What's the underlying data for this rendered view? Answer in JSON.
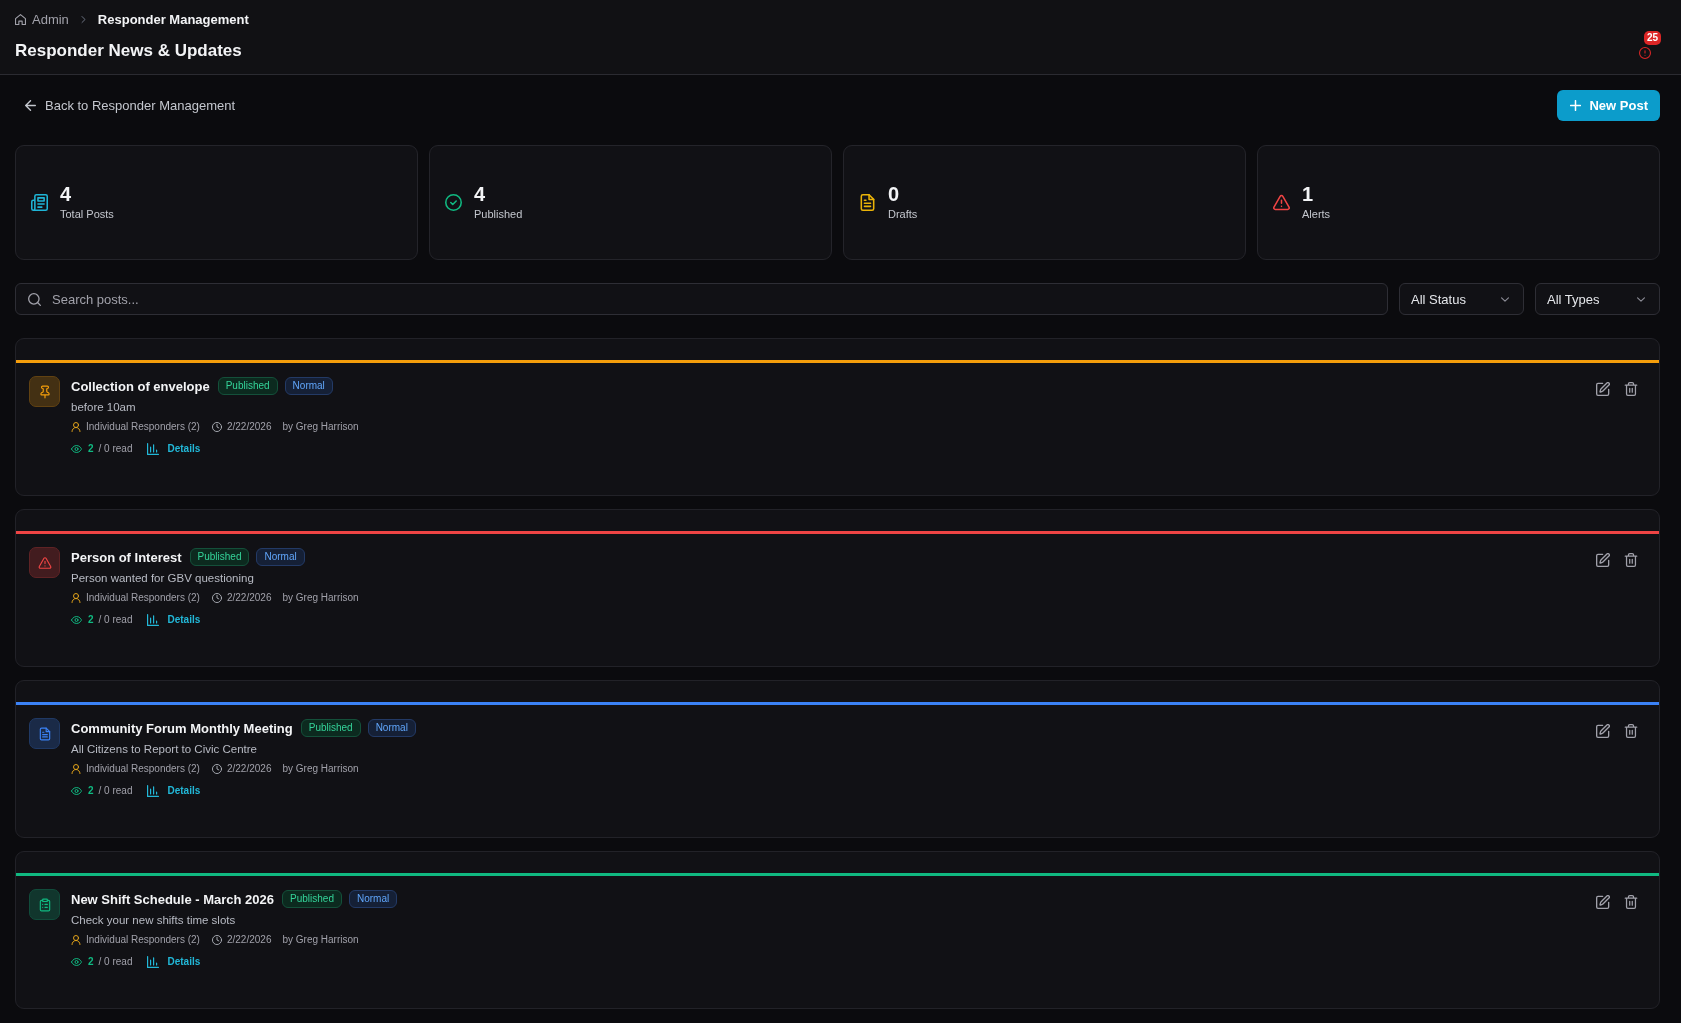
{
  "breadcrumb": [
    {
      "label": "Admin",
      "current": false
    },
    {
      "label": "Responder Management",
      "current": true
    }
  ],
  "page_title": "Responder News & Updates",
  "notifications": {
    "count": "25"
  },
  "back_link": "Back to Responder Management",
  "new_post_button": "New Post",
  "stats": [
    {
      "value": "4",
      "label": "Total Posts",
      "kind": "total",
      "color": "#1fb5d6"
    },
    {
      "value": "4",
      "label": "Published",
      "kind": "published",
      "color": "#10b981"
    },
    {
      "value": "0",
      "label": "Drafts",
      "kind": "drafts",
      "color": "#eab308"
    },
    {
      "value": "1",
      "label": "Alerts",
      "kind": "alerts",
      "color": "#ef4444"
    }
  ],
  "search": {
    "placeholder": "Search posts..."
  },
  "filters": [
    {
      "value": "All Status"
    },
    {
      "value": "All Types"
    }
  ],
  "posts": [
    {
      "title": "Collection of envelope",
      "kind": "pin",
      "color": "#f59e0b",
      "badges": [
        {
          "label": "Published",
          "kind": "status"
        },
        {
          "label": "Normal",
          "kind": "priority"
        }
      ],
      "summary": "before 10am",
      "audience": "Individual Responders (2)",
      "date": "2/22/2026",
      "author": "by Greg Harrison",
      "views": "2",
      "read": "/ 0 read",
      "details_link": "Details"
    },
    {
      "title": "Person of Interest",
      "kind": "alert",
      "color": "#ef4444",
      "badges": [
        {
          "label": "Published",
          "kind": "status"
        },
        {
          "label": "Normal",
          "kind": "priority"
        }
      ],
      "summary": "Person wanted for GBV questioning",
      "audience": "Individual Responders (2)",
      "date": "2/22/2026",
      "author": "by Greg Harrison",
      "views": "2",
      "read": "/ 0 read",
      "details_link": "Details"
    },
    {
      "title": "Community Forum Monthly Meeting",
      "kind": "document",
      "color": "#3b82f6",
      "badges": [
        {
          "label": "Published",
          "kind": "status"
        },
        {
          "label": "Normal",
          "kind": "priority"
        }
      ],
      "summary": "All Citizens to Report to Civic Centre",
      "audience": "Individual Responders (2)",
      "date": "2/22/2026",
      "author": "by Greg Harrison",
      "views": "2",
      "read": "/ 0 read",
      "details_link": "Details"
    },
    {
      "title": "New Shift Schedule - March 2026",
      "kind": "clipboard",
      "color": "#10b981",
      "badges": [
        {
          "label": "Published",
          "kind": "status"
        },
        {
          "label": "Normal",
          "kind": "priority"
        }
      ],
      "summary": "Check your new shifts time slots",
      "audience": "Individual Responders (2)",
      "date": "2/22/2026",
      "author": "by Greg Harrison",
      "views": "2",
      "read": "/ 0 read",
      "details_link": "Details"
    }
  ]
}
